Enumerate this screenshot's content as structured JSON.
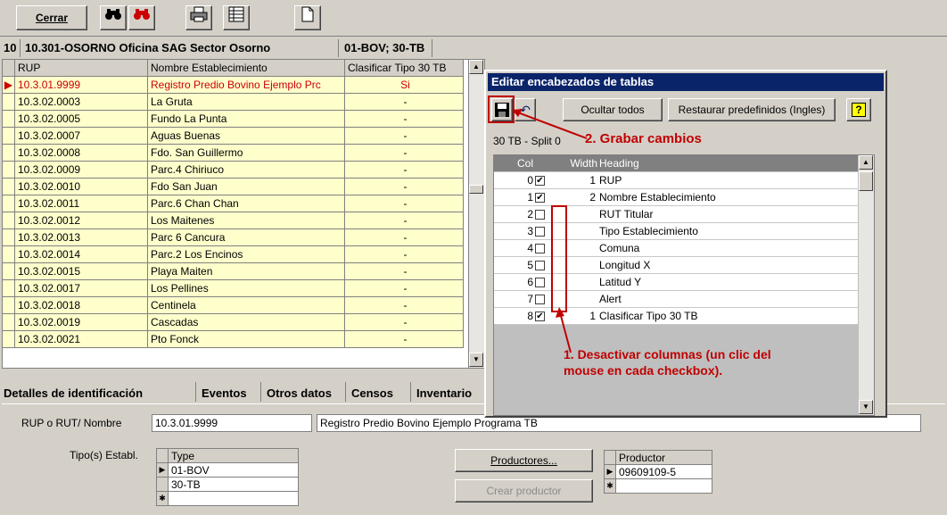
{
  "toolbar": {
    "close_label": "Cerrar",
    "icons": [
      "binoculars-icon",
      "binoculars-red-icon",
      "printer-icon",
      "spreadsheet-icon",
      "new-document-icon"
    ]
  },
  "header": {
    "number": "10",
    "office": "10.301-OSORNO Oficina SAG Sector Osorno",
    "filter": "01-BOV; 30-TB"
  },
  "grid": {
    "columns": [
      "RUP",
      "Nombre Establecimiento",
      "Clasificar Tipo 30 TB"
    ],
    "rows": [
      [
        "10.3.01.9999",
        "Registro Predio Bovino Ejemplo Prc",
        "Si"
      ],
      [
        "10.3.02.0003",
        "La Gruta",
        "-"
      ],
      [
        "10.3.02.0005",
        "Fundo La Punta",
        "-"
      ],
      [
        "10.3.02.0007",
        "Aguas Buenas",
        "-"
      ],
      [
        "10.3.02.0008",
        "Fdo. San Guillermo",
        "-"
      ],
      [
        "10.3.02.0009",
        "Parc.4 Chiriuco",
        "-"
      ],
      [
        "10.3.02.0010",
        "Fdo San Juan",
        "-"
      ],
      [
        "10.3.02.0011",
        "Parc.6 Chan Chan",
        "-"
      ],
      [
        "10.3.02.0012",
        "Los Maitenes",
        "-"
      ],
      [
        "10.3.02.0013",
        "Parc 6 Cancura",
        "-"
      ],
      [
        "10.3.02.0014",
        "Parc.2 Los Encinos",
        "-"
      ],
      [
        "10.3.02.0015",
        "Playa Maiten",
        "-"
      ],
      [
        "10.3.02.0017",
        "Los Pellines",
        "-"
      ],
      [
        "10.3.02.0018",
        "Centinela",
        "-"
      ],
      [
        "10.3.02.0019",
        "Cascadas",
        "-"
      ],
      [
        "10.3.02.0021",
        "Pto Fonck",
        "-"
      ]
    ]
  },
  "tabs": [
    {
      "label": "Detalles de identificación"
    },
    {
      "label": "Eventos"
    },
    {
      "label": "Otros datos"
    },
    {
      "label": "Censos"
    },
    {
      "label": "Inventario"
    }
  ],
  "details": {
    "rup_label": "RUP o RUT/ Nombre",
    "rup_value": "10.3.01.9999",
    "name_value": "Registro Predio Bovino Ejemplo Programa TB",
    "tipo_label": "Tipo(s) Establ.",
    "type_header": "Type",
    "types": [
      "01-BOV",
      "30-TB"
    ],
    "productores_button": "Productores...",
    "crear_productor_button": "Crear productor",
    "productor_header": "Productor",
    "productores": [
      "09609109-5"
    ]
  },
  "dialog": {
    "title": "Editar encabezados de tablas",
    "ocultar_label": "Ocultar todos",
    "restaurar_label": "Restaurar predefinidos (Ingles)",
    "split_label": "30 TB - Split 0",
    "grabar_annotation": "2. Grabar cambios",
    "desactivar_annotation_1": "1. Desactivar columnas (un clic del",
    "desactivar_annotation_2": "mouse en cada checkbox).",
    "headers": [
      "Col",
      "",
      "Width",
      "Heading"
    ],
    "rows": [
      {
        "col": "0",
        "checked": true,
        "width": "1",
        "heading": "RUP"
      },
      {
        "col": "1",
        "checked": true,
        "width": "2",
        "heading": "Nombre Establecimiento"
      },
      {
        "col": "2",
        "checked": false,
        "width": "",
        "heading": "RUT Titular"
      },
      {
        "col": "3",
        "checked": false,
        "width": "",
        "heading": "Tipo Establecimiento"
      },
      {
        "col": "4",
        "checked": false,
        "width": "",
        "heading": "Comuna"
      },
      {
        "col": "5",
        "checked": false,
        "width": "",
        "heading": "Longitud X"
      },
      {
        "col": "6",
        "checked": false,
        "width": "",
        "heading": "Latitud Y"
      },
      {
        "col": "7",
        "checked": false,
        "width": "",
        "heading": "Alert"
      },
      {
        "col": "8",
        "checked": true,
        "width": "1",
        "heading": "Clasificar Tipo 30 TB"
      }
    ]
  }
}
